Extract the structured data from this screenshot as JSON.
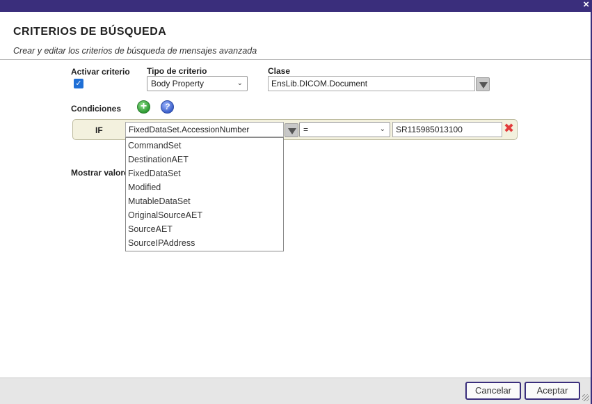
{
  "window": {
    "close_glyph": "×"
  },
  "header": {
    "title": "CRITERIOS DE BÚSQUEDA",
    "subtitle": "Crear y editar los criterios de búsqueda de mensajes avanzada"
  },
  "form": {
    "activar_label": "Activar criterio",
    "activar_checked": true,
    "tipo_label": "Tipo de criterio",
    "tipo_value": "Body Property",
    "clase_label": "Clase",
    "clase_value": "EnsLib.DICOM.Document",
    "condiciones_label": "Condiciones",
    "mostrar_label": "Mostrar valore"
  },
  "condition": {
    "if_label": "IF",
    "property_value": "FixedDataSet.AccessionNumber",
    "operator_value": "=",
    "value": "SR115985013100"
  },
  "dropdown": {
    "items": [
      "CommandSet",
      "DestinationAET",
      "FixedDataSet",
      "Modified",
      "MutableDataSet",
      "OriginalSourceAET",
      "SourceAET",
      "SourceIPAddress"
    ]
  },
  "footer": {
    "cancel_label": "Cancelar",
    "accept_label": "Aceptar"
  },
  "icons": {
    "add": "add-icon",
    "help": "help-icon",
    "delete": "delete-icon",
    "check": "check-icon"
  },
  "colors": {
    "accent": "#3a2e7c",
    "checkbox": "#1f6fd6",
    "condition_row": "#f3f1de",
    "delete": "#e23b3b"
  }
}
